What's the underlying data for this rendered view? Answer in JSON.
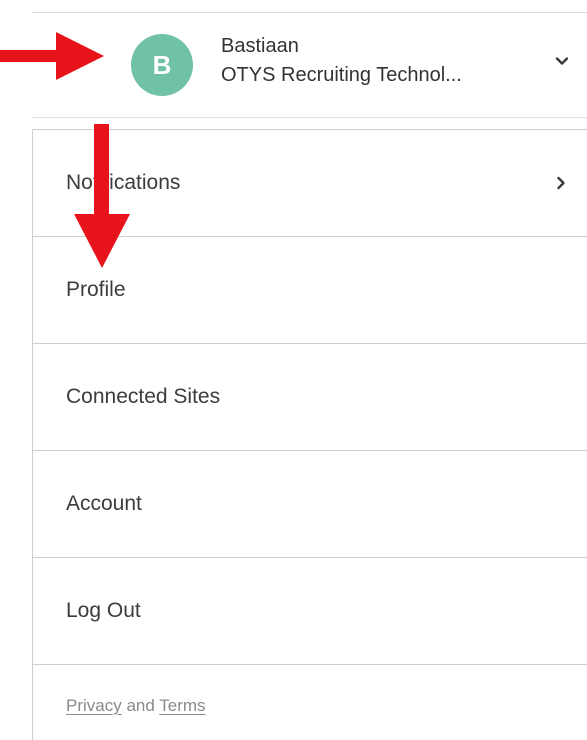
{
  "user": {
    "avatar_initial": "B",
    "name": "Bastiaan",
    "organization": "OTYS Recruiting Technol..."
  },
  "icons": {
    "header_toggle": "chevron-down-icon",
    "submenu": "chevron-right-icon",
    "annotation": "red-arrow-icon"
  },
  "menu": {
    "items": [
      {
        "label": "Notifications",
        "has_submenu": true
      },
      {
        "label": "Profile"
      },
      {
        "label": "Connected Sites"
      },
      {
        "label": "Account"
      },
      {
        "label": "Log Out"
      }
    ]
  },
  "footer": {
    "privacy_label": "Privacy",
    "connector": "and",
    "terms_label": "Terms"
  },
  "colors": {
    "avatar": "#6fc1a7",
    "annotation_arrow": "#e8141b",
    "divider": "#cfcfcf"
  }
}
